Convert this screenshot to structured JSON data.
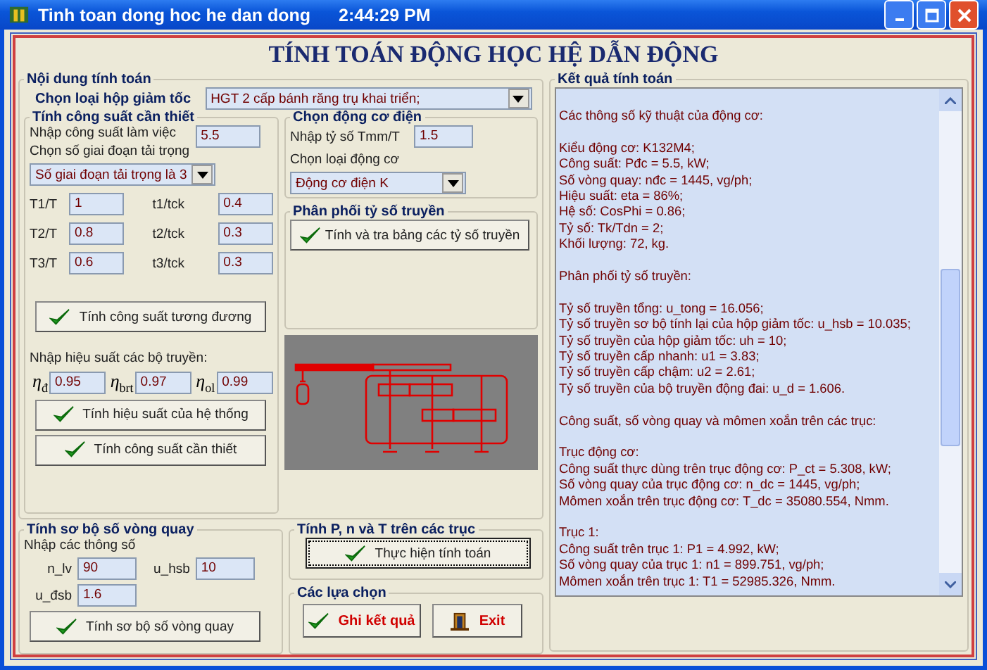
{
  "window": {
    "title": "Tinh toan dong hoc he dan dong",
    "clock": "2:44:29 PM"
  },
  "heading": "TÍNH TOÁN ĐỘNG HỌC HỆ DẪN ĐỘNG",
  "content_group": {
    "title": "Nội dung tính toán",
    "gearbox_label": "Chọn loại hộp giảm tốc",
    "gearbox_value": "HGT 2 cấp bánh răng trụ khai triển;"
  },
  "power_group": {
    "title": "Tính công suất cần thiết",
    "work_power_label": "Nhập công suất làm việc",
    "work_power_value": "5.5",
    "load_stage_label": "Chọn số giai đoạn tải trọng",
    "load_stage_value": "Số giai đoạn tải trọng là 3",
    "load_rows": [
      {
        "t_label": "T1/T",
        "t_value": "1",
        "tck_label": "t1/tck",
        "tck_value": "0.4"
      },
      {
        "t_label": "T2/T",
        "t_value": "0.8",
        "tck_label": "t2/tck",
        "tck_value": "0.3"
      },
      {
        "t_label": "T3/T",
        "t_value": "0.6",
        "tck_label": "t3/tck",
        "tck_value": "0.3"
      }
    ],
    "equivalent_button": "Tính công suất tương đương",
    "efficiency_label": "Nhập hiệu suất các bộ truyền:",
    "efficiencies": [
      {
        "symbol": "η$_{đ}$",
        "value": "0.95"
      },
      {
        "symbol": "η$_{brt}$",
        "value": "0.97"
      },
      {
        "symbol": "η$_{ol}$",
        "value": "0.99"
      }
    ],
    "efficiency_button": "Tính hiệu suất của hệ thống",
    "required_button": "Tính công suất cần thiết"
  },
  "motor_group": {
    "title": "Chọn động cơ điện",
    "ratio_label": "Nhập tỷ số Tmm/T",
    "ratio_value": "1.5",
    "type_label": "Chọn loại động cơ",
    "type_value": "Động cơ điện K"
  },
  "ratio_group": {
    "title": "Phân phối tỷ số truyền",
    "button": "Tính và tra bảng các tỷ số truyền"
  },
  "speed_group": {
    "title": "Tính sơ bộ số vòng quay",
    "params_label": "Nhập các thông số",
    "n_lv_label": "n_lv",
    "n_lv_value": "90",
    "u_hsb_label": "u_hsb",
    "u_hsb_value": "10",
    "u_dsb_label": "u_đsb",
    "u_dsb_value": "1.6",
    "button": "Tính sơ bộ số vòng quay"
  },
  "shaft_group": {
    "title": "Tính P,  n và T trên các trục",
    "button": "Thực hiện tính toán",
    "focused": true
  },
  "options_group": {
    "title": "Các lựa chọn",
    "buttons": [
      {
        "label": "Ghi kết quả",
        "kind": "save"
      },
      {
        "label": "Exit",
        "kind": "exit"
      }
    ]
  },
  "results": {
    "title": "Kết quả tính toán",
    "paragraphs": [
      [
        "Các thông số kỹ thuật của động cơ:"
      ],
      [
        "Kiểu động cơ: K132M4;",
        "Công suất: Pđc = 5.5, kW;",
        "Số vòng quay: nđc = 1445, vg/ph;",
        "Hiệu suất: eta = 86%;",
        "Hệ số: CosPhi = 0.86;",
        "Tỷ số: Tk/Tdn = 2;",
        "Khối lượng: 72, kg."
      ],
      [
        "Phân phối tỷ số truyền:"
      ],
      [
        "Tỷ số truyền tổng: u_tong = 16.056;",
        "Tỷ số truyền sơ bộ tính lại của hộp giảm tốc: u_hsb = 10.035;",
        "Tỷ số truyền của hộp giảm tốc: uh = 10;",
        "Tỷ số truyền cấp nhanh: u1 = 3.83;",
        "Tỷ số truyền cấp chậm: u2 = 2.61;",
        "Tỷ số truyền của bộ truyền động đai: u_d = 1.606."
      ],
      [
        "Công suất, số vòng quay và mômen xoắn trên các trục:"
      ],
      [
        "Trục động cơ:",
        "Công suất thực dùng trên trục động cơ: P_ct = 5.308, kW;",
        "Số vòng quay của trục động cơ: n_dc = 1445, vg/ph;",
        "Mômen xoắn trên trục động cơ: T_dc = 35080.554, Nmm."
      ],
      [
        "Trục 1:",
        "Công suất trên trục 1: P1 = 4.992, kW;",
        "Số vòng quay của trục 1: n1 = 899.751, vg/ph;",
        "Mômen xoắn trên trục 1: T1 = 52985.326, Nmm."
      ]
    ]
  }
}
